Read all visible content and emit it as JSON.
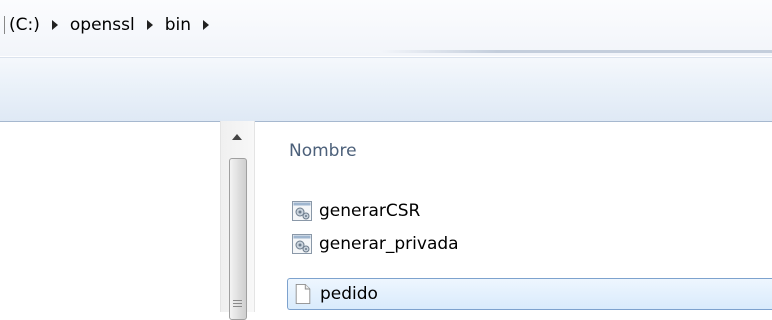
{
  "addressbar": {
    "breadcrumbs": [
      "(C:)",
      "openssl",
      "bin"
    ]
  },
  "filelist": {
    "column_name": "Nombre",
    "files": [
      {
        "name": "generarCSR",
        "icon": "batch-file-icon",
        "selected": false
      },
      {
        "name": "generar_privada",
        "icon": "batch-file-icon",
        "selected": false
      },
      {
        "name": "pedido",
        "icon": "document-icon",
        "selected": true
      }
    ]
  }
}
